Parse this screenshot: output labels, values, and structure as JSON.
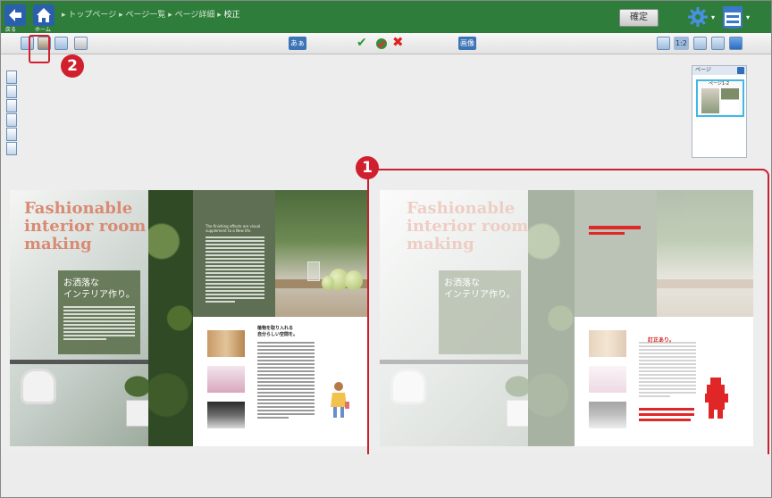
{
  "header": {
    "back_label": "戻る",
    "home_label": "ホーム",
    "breadcrumb": [
      "トップページ",
      "ページ一覧",
      "ページ詳細"
    ],
    "breadcrumb_current": "校正",
    "confirm_label": "確定"
  },
  "toolbar": {
    "text_buttons": [
      "あぁ",
      "画像"
    ],
    "zoom_label": "1:2"
  },
  "thumbnail_panel": {
    "title": "ページ",
    "selected_page_label": "ページ1-2"
  },
  "callouts": [
    "1",
    "2"
  ],
  "spread_left": {
    "headline": [
      "Fashionable",
      "interior room",
      "making"
    ],
    "jp_title": "お洒落な\nインテリア作り。",
    "panel_heading": "The finishing effects are visual\nsupplement to a New life.",
    "lower_heading": "植物を取り入れる\n自分らしい空間を。"
  },
  "spread_right": {
    "headline": [
      "Fashionable",
      "interior room",
      "making"
    ],
    "jp_title": "お洒落な\nインテリア作り。",
    "red_note": "訂正あり。"
  },
  "colors": {
    "header_green": "#2f7d3a",
    "accent_red": "#d01f2e",
    "headline_salmon": "#d98a74",
    "panel_green": "#5e6f53"
  }
}
